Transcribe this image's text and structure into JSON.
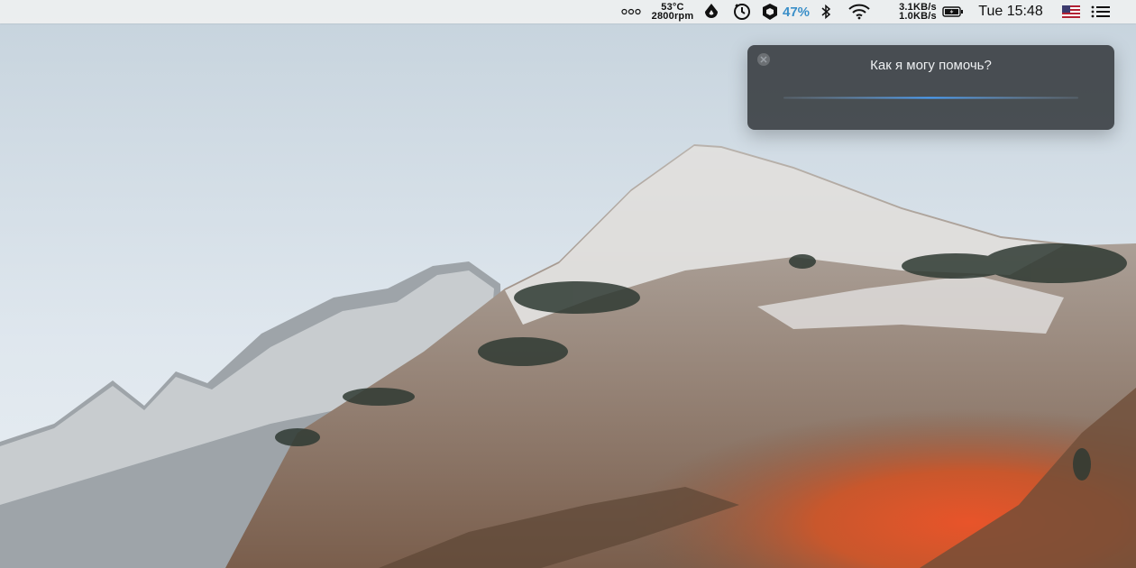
{
  "menubar": {
    "sensors": {
      "temperature": "53°C",
      "fan_speed": "2800rpm"
    },
    "activity_percent": "47%",
    "network": {
      "upload": "3.1KB/s",
      "download": "1.0KB/s"
    },
    "clock": "Tue 15:48",
    "icons": {
      "more": "ellipsis-icon",
      "drop": "drop-icon",
      "timer": "timer-icon",
      "box": "box-icon",
      "bluetooth": "bluetooth-icon",
      "wifi": "wifi-icon",
      "battery": "battery-icon",
      "flag": "us-flag-icon",
      "menu": "list-icon"
    }
  },
  "siri": {
    "prompt": "Как я могу помочь?",
    "close_icon": "close-icon"
  }
}
